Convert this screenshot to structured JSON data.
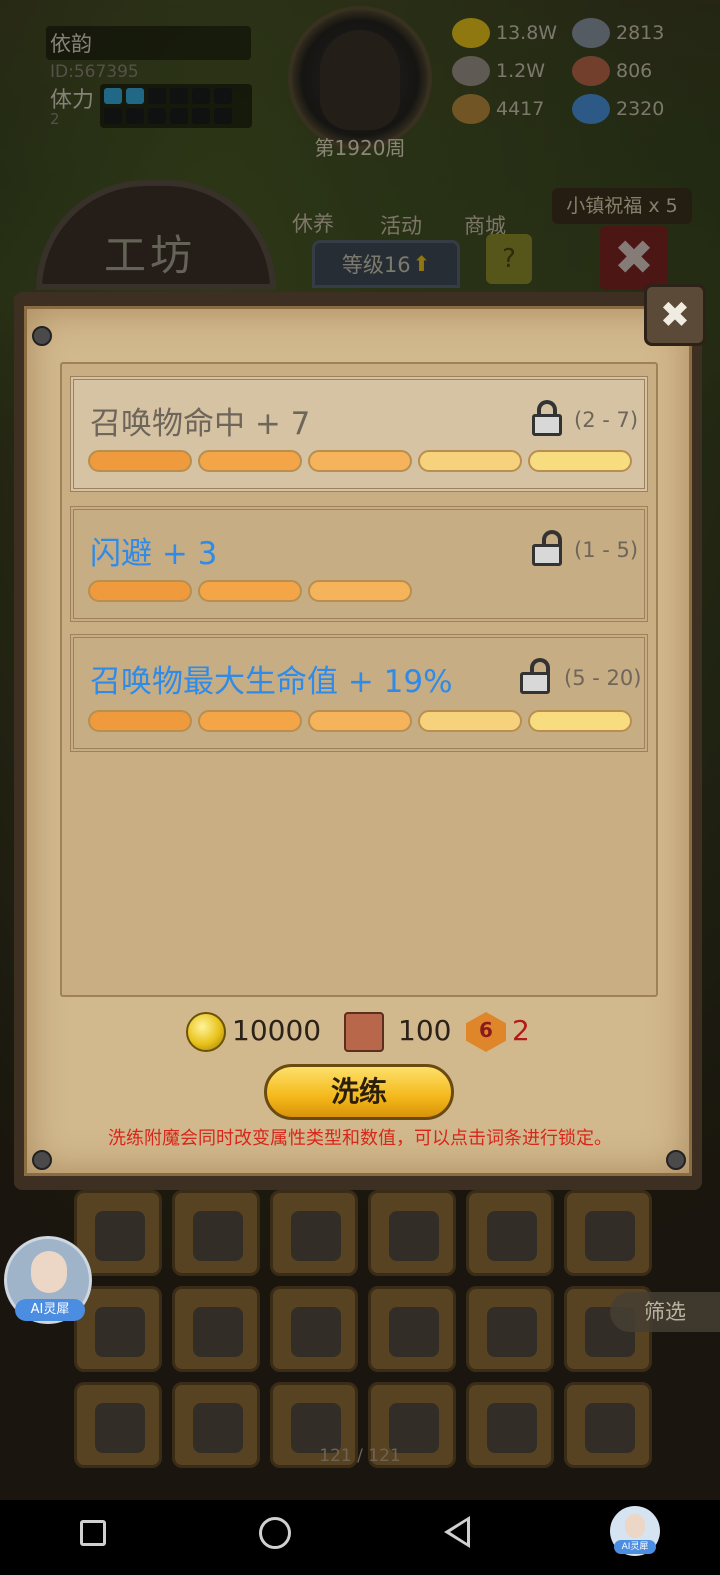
{
  "hud": {
    "player_name": "依韵",
    "player_id": "ID:567395",
    "stamina_label": "体力",
    "stamina_value": "2",
    "stamina_filled": 2,
    "stamina_total": 12,
    "week": "第1920周",
    "resources": [
      {
        "icon": "gold-coin-icon",
        "value": "13.8W",
        "color": "#e8c21a"
      },
      {
        "icon": "iron-ingot-icon",
        "value": "2813",
        "color": "#8a94a0"
      },
      {
        "icon": "ore-icon",
        "value": "1.2W",
        "color": "#9a9488"
      },
      {
        "icon": "enchant-scroll-icon",
        "value": "806",
        "color": "#b9674a"
      },
      {
        "icon": "wood-log-icon",
        "value": "4417",
        "color": "#b88a3a"
      },
      {
        "icon": "crystal-icon",
        "value": "2320",
        "color": "#4a90d8"
      }
    ]
  },
  "menu": {
    "nurture": "休养",
    "activity": "活动",
    "shop": "商城",
    "town_blessing": "小镇祝福 x 5",
    "workshop_title": "工坊",
    "level": "等级16",
    "help": "?"
  },
  "dialog": {
    "attributes": [
      {
        "text": "召唤物命中 + 7",
        "range": "(2 - 7)",
        "locked_style": true,
        "color": "gray",
        "segments": 5
      },
      {
        "text": "闪避 + 3",
        "range": "(1 - 5)",
        "locked_style": false,
        "color": "blue",
        "segments": 3
      },
      {
        "text": "召唤物最大生命值 + 19%",
        "range": "(5 - 20)",
        "locked_style": false,
        "color": "blue",
        "segments": 5
      }
    ],
    "costs": {
      "gold": "10000",
      "scroll": "100",
      "gem_level": "6",
      "gem": "2"
    },
    "refine_button": "洗练",
    "hint": "洗练附魔会同时改变属性类型和数值，可以点击词条进行锁定。"
  },
  "inventory": {
    "page": "121 / 121",
    "filter": "筛选"
  },
  "ai_assistant": {
    "label": "AI灵犀"
  },
  "colors": {
    "accent_blue": "#2f8be7",
    "hint_red": "#d8261a",
    "button_gold": "#f4b81a"
  }
}
